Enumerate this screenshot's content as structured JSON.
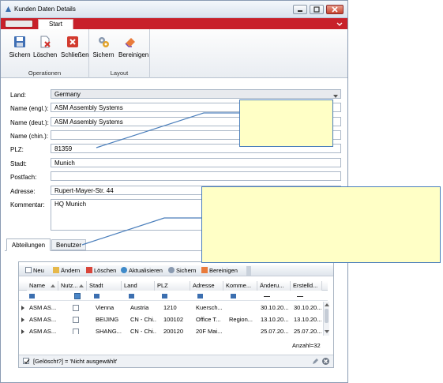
{
  "window": {
    "title": "Kunden Daten Details"
  },
  "ribbon": {
    "tab": "Start",
    "groups": [
      {
        "label": "Operationen",
        "buttons": [
          "Sichern",
          "Löschen",
          "Schließen"
        ]
      },
      {
        "label": "Layout",
        "buttons": [
          "Sichern",
          "Bereinigen"
        ]
      }
    ]
  },
  "form": {
    "land_label": "Land:",
    "land_value": "Germany",
    "name_engl_label": "Name (engl.):",
    "name_engl_value": "ASM Assembly Systems",
    "name_deut_label": "Name (deut.):",
    "name_deut_value": "ASM Assembly Systems",
    "name_chin_label": "Name (chin.):",
    "name_chin_value": "",
    "plz_label": "PLZ:",
    "plz_value": "81359",
    "stadt_label": "Stadt:",
    "stadt_value": "Munich",
    "postfach_label": "Postfach:",
    "postfach_value": "",
    "adresse_label": "Adresse:",
    "adresse_value": "Rupert-Mayer-Str. 44",
    "kommentar_label": "Kommentar:",
    "kommentar_value": "HQ Munich"
  },
  "tabs": [
    "Abteilungen",
    "Benutzer"
  ],
  "toolbar": {
    "neu": "Neu",
    "aendern": "Ändern",
    "loeschen": "Löschen",
    "aktualisieren": "Aktualisieren",
    "sichern": "Sichern",
    "bereinigen": "Bereinigen"
  },
  "grid": {
    "columns": [
      "Name",
      "Nutz...",
      "Stadt",
      "Land",
      "PLZ",
      "Adresse",
      "Komme...",
      "Änderu...",
      "Erstelld..."
    ],
    "rows": [
      [
        "ASM AS...",
        "",
        "Vienna",
        "Austria",
        "1210",
        "Kuersch...",
        "",
        "30.10.20...",
        "30.10.20..."
      ],
      [
        "ASM AS...",
        "",
        "BEIJING",
        "CN - Chi...",
        "100102",
        "Office T...",
        "Region...",
        "13.10.20...",
        "13.10.20..."
      ],
      [
        "ASM AS...",
        "",
        "SHANG...",
        "CN - Chi...",
        "200120",
        "20F Mai...",
        "",
        "25.07.20...",
        "25.07.20..."
      ]
    ],
    "count": "Anzahl=32",
    "filter": "[Gelöscht?] = 'Nicht ausgewählt'"
  },
  "colors": {
    "ribbon_red": "#c8202a",
    "callout_fill": "#ffffc6",
    "callout_border": "#4a7ebb"
  }
}
